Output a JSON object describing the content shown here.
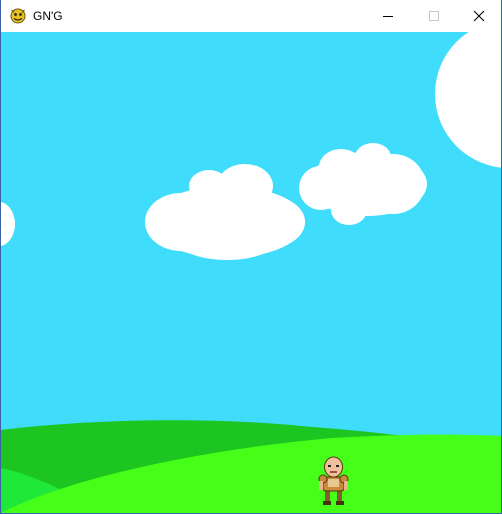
{
  "window": {
    "title": "GN'G",
    "app_icon": "pygame-snake-icon",
    "controls": {
      "minimize_icon": "minimize-icon",
      "maximize_icon": "maximize-icon",
      "close_icon": "close-icon"
    }
  },
  "scene": {
    "colors": {
      "sky": "#3fdcfc",
      "cloud": "#ffffff",
      "hill_back": "#1cc520",
      "hill_front": "#45ff19",
      "hill_left_accent": "#1fe838"
    },
    "player": {
      "sprite": "bald-warrior-sprite"
    }
  }
}
